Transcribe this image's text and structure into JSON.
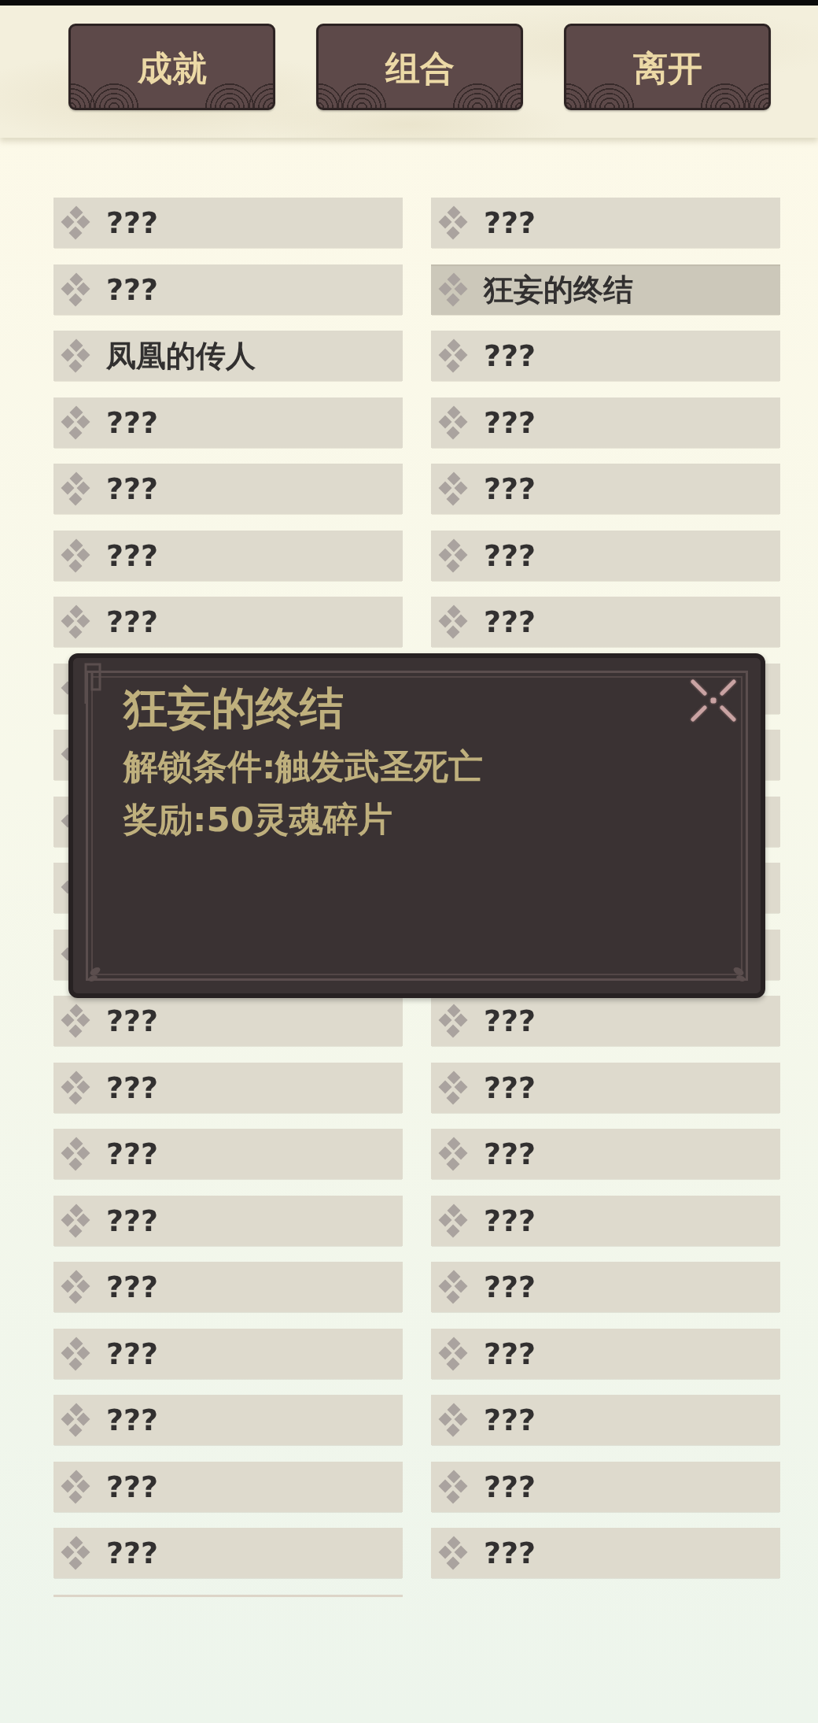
{
  "header": {
    "buttons": [
      {
        "label": "成就"
      },
      {
        "label": "组合"
      },
      {
        "label": "离开"
      }
    ]
  },
  "achievements": [
    {
      "label": "???",
      "selected": false
    },
    {
      "label": "???",
      "selected": false
    },
    {
      "label": "???",
      "selected": false
    },
    {
      "label": "狂妄的终结",
      "selected": true
    },
    {
      "label": "凤凰的传人",
      "selected": false
    },
    {
      "label": "???",
      "selected": false
    },
    {
      "label": "???",
      "selected": false
    },
    {
      "label": "???",
      "selected": false
    },
    {
      "label": "???",
      "selected": false
    },
    {
      "label": "???",
      "selected": false
    },
    {
      "label": "???",
      "selected": false
    },
    {
      "label": "???",
      "selected": false
    },
    {
      "label": "???",
      "selected": false
    },
    {
      "label": "???",
      "selected": false
    },
    {
      "selected": false
    },
    {
      "selected": false
    },
    {
      "selected": false
    },
    {
      "selected": false
    },
    {
      "selected": false
    },
    {
      "selected": false
    },
    {
      "selected": false
    },
    {
      "selected": false
    },
    {
      "selected": false
    },
    {
      "selected": false
    },
    {
      "label": "???",
      "selected": false
    },
    {
      "label": "???",
      "selected": false
    },
    {
      "label": "???",
      "selected": false
    },
    {
      "label": "???",
      "selected": false
    },
    {
      "label": "???",
      "selected": false
    },
    {
      "label": "???",
      "selected": false
    },
    {
      "label": "???",
      "selected": false
    },
    {
      "label": "???",
      "selected": false
    },
    {
      "label": "???",
      "selected": false
    },
    {
      "label": "???",
      "selected": false
    },
    {
      "label": "???",
      "selected": false
    },
    {
      "label": "???",
      "selected": false
    },
    {
      "label": "???",
      "selected": false
    },
    {
      "label": "???",
      "selected": false
    },
    {
      "label": "???",
      "selected": false
    },
    {
      "label": "???",
      "selected": false
    },
    {
      "label": "???",
      "selected": false
    },
    {
      "label": "???",
      "selected": false
    }
  ],
  "popup": {
    "title": "狂妄的终结",
    "lines": [
      "解锁条件:触发武圣死亡",
      "奖励:50灵魂碎片"
    ]
  }
}
